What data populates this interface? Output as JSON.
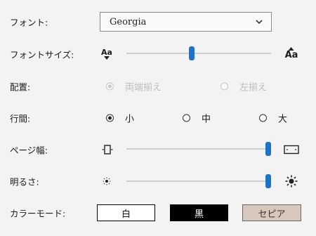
{
  "font": {
    "label": "フォント:",
    "selected": "Georgia"
  },
  "font_size": {
    "label": "フォントサイズ:",
    "small_icon_text": "Aa",
    "large_icon_text": "Aa",
    "value_fraction": 0.45
  },
  "alignment": {
    "label": "配置:",
    "options": [
      {
        "label": "両端揃え",
        "selected": true,
        "disabled": true
      },
      {
        "label": "左揃え",
        "selected": false,
        "disabled": true
      }
    ]
  },
  "line_spacing": {
    "label": "行間:",
    "options": [
      {
        "label": "小",
        "selected": true
      },
      {
        "label": "中",
        "selected": false
      },
      {
        "label": "大",
        "selected": false
      }
    ]
  },
  "page_width": {
    "label": "ページ幅:",
    "value_fraction": 0.98
  },
  "brightness": {
    "label": "明るさ:",
    "value_fraction": 0.98
  },
  "color_mode": {
    "label": "カラーモード:",
    "options": [
      {
        "label": "白",
        "color": "#ffffff"
      },
      {
        "label": "黒",
        "color": "#000000"
      },
      {
        "label": "セピア",
        "color": "#d7c8bd"
      }
    ]
  },
  "accent_color": "#1d72c9"
}
